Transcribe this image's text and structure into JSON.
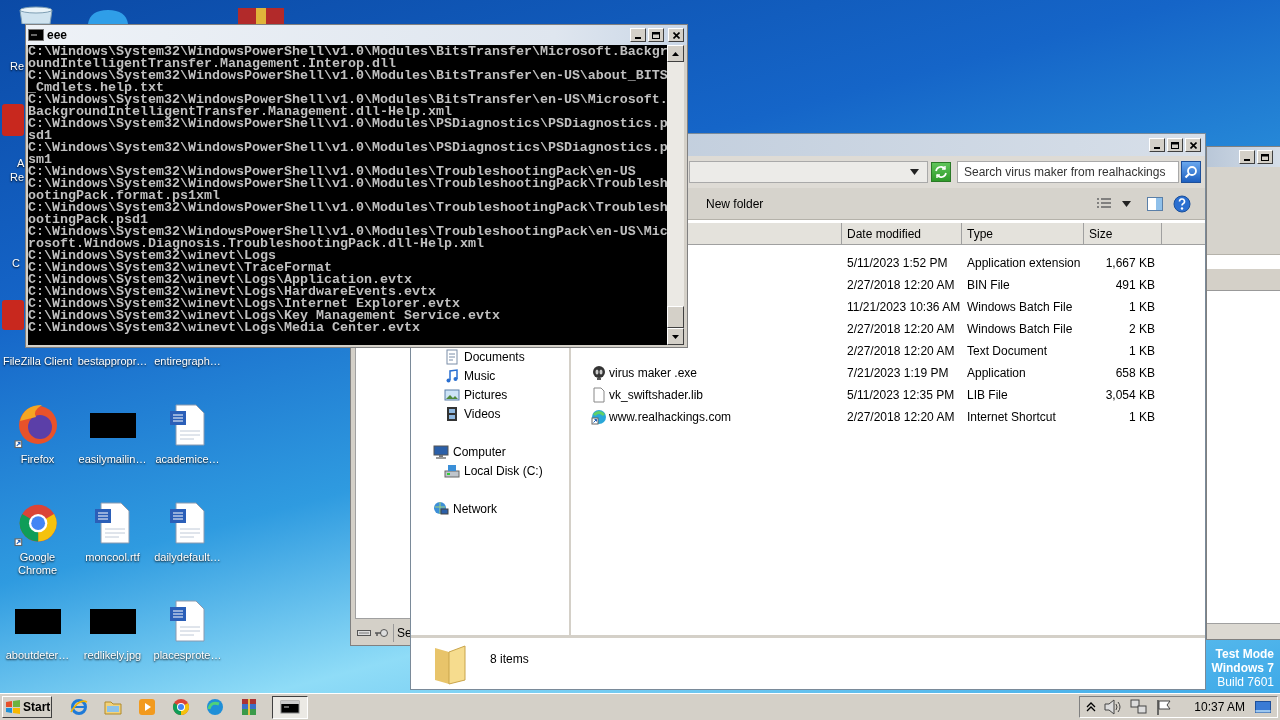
{
  "desktop": {
    "partial_labels": [
      "Re",
      "A",
      "Re",
      "C"
    ],
    "icons": [
      {
        "label": "FileZilla Client",
        "kind": "covered"
      },
      {
        "label": "bestappropr…",
        "kind": "covered"
      },
      {
        "label": "entiregraph…",
        "kind": "covered"
      },
      {
        "label": "Firefox",
        "kind": "firefox"
      },
      {
        "label": "easilymailin…",
        "kind": "thumb"
      },
      {
        "label": "academice…",
        "kind": "word"
      },
      {
        "label": "Google Chrome",
        "kind": "chrome"
      },
      {
        "label": "moncool.rtf",
        "kind": "word"
      },
      {
        "label": "dailydefault…",
        "kind": "word"
      },
      {
        "label": "aboutdeter…",
        "kind": "thumb"
      },
      {
        "label": "redlikely.jpg",
        "kind": "thumb"
      },
      {
        "label": "placesprote…",
        "kind": "word"
      }
    ]
  },
  "console": {
    "title": "eee",
    "lines": [
      "C:\\Windows\\System32\\WindowsPowerShell\\v1.0\\Modules\\BitsTransfer\\Microsoft.Backgr",
      "oundIntelligentTransfer.Management.Interop.dll",
      "C:\\Windows\\System32\\WindowsPowerShell\\v1.0\\Modules\\BitsTransfer\\en-US\\about_BITS",
      "_Cmdlets.help.txt",
      "C:\\Windows\\System32\\WindowsPowerShell\\v1.0\\Modules\\BitsTransfer\\en-US\\Microsoft.",
      "BackgroundIntelligentTransfer.Management.dll-Help.xml",
      "C:\\Windows\\System32\\WindowsPowerShell\\v1.0\\Modules\\PSDiagnostics\\PSDiagnostics.p",
      "sd1",
      "C:\\Windows\\System32\\WindowsPowerShell\\v1.0\\Modules\\PSDiagnostics\\PSDiagnostics.p",
      "sm1",
      "C:\\Windows\\System32\\WindowsPowerShell\\v1.0\\Modules\\TroubleshootingPack\\en-US",
      "C:\\Windows\\System32\\WindowsPowerShell\\v1.0\\Modules\\TroubleshootingPack\\Troublesh",
      "ootingPack.format.ps1xml",
      "C:\\Windows\\System32\\WindowsPowerShell\\v1.0\\Modules\\TroubleshootingPack\\Troublesh",
      "ootingPack.psd1",
      "C:\\Windows\\System32\\WindowsPowerShell\\v1.0\\Modules\\TroubleshootingPack\\en-US\\Mic",
      "rosoft.Windows.Diagnosis.TroubleshootingPack.dll-Help.xml",
      "C:\\Windows\\System32\\winevt\\Logs",
      "C:\\Windows\\System32\\winevt\\TraceFormat",
      "C:\\Windows\\System32\\winevt\\Logs\\Application.evtx",
      "C:\\Windows\\System32\\winevt\\Logs\\HardwareEvents.evtx",
      "C:\\Windows\\System32\\winevt\\Logs\\Internet Explorer.evtx",
      "C:\\Windows\\System32\\winevt\\Logs\\Key Management Service.evtx",
      "C:\\Windows\\System32\\winevt\\Logs\\Media Center.evtx"
    ]
  },
  "explorer": {
    "search": {
      "placeholder": "Search virus maker from realhackings"
    },
    "toolbar": {
      "new_folder": "New folder"
    },
    "columns": [
      "Date modified",
      "Type",
      "Size"
    ],
    "navigation": [
      {
        "children": [
          {
            "label": "Documents",
            "kind": "documents"
          },
          {
            "label": "Music",
            "kind": "music"
          },
          {
            "label": "Pictures",
            "kind": "pictures"
          },
          {
            "label": "Videos",
            "kind": "videos"
          }
        ]
      },
      {
        "label": "Computer",
        "kind": "computer",
        "children": [
          {
            "label": "Local Disk (C:)",
            "kind": "disk"
          }
        ]
      },
      {
        "label": "Network",
        "kind": "network"
      }
    ],
    "files": [
      {
        "date": "5/11/2023 1:52 PM",
        "type": "Application extension",
        "size": "1,667 KB"
      },
      {
        "date": "2/27/2018 12:20 AM",
        "type": "BIN File",
        "size": "491 KB"
      },
      {
        "date": "11/21/2023 10:36 AM",
        "type": "Windows Batch File",
        "size": "1 KB"
      },
      {
        "date": "2/27/2018 12:20 AM",
        "type": "Windows Batch File",
        "size": "2 KB"
      },
      {
        "date": "2/27/2018 12:20 AM",
        "type": "Text Document",
        "size": "1 KB"
      },
      {
        "name": "virus maker .exe",
        "kind": "app",
        "date": "7/21/2023 1:19 PM",
        "type": "Application",
        "size": "658 KB"
      },
      {
        "name": "vk_swiftshader.lib",
        "kind": "file",
        "date": "5/11/2023 12:35 PM",
        "type": "LIB File",
        "size": "3,054 KB"
      },
      {
        "name": "www.realhackings.com",
        "kind": "shortcut",
        "date": "2/27/2018 12:20 AM",
        "type": "Internet Shortcut",
        "size": "1 KB"
      }
    ],
    "status": "8 items"
  },
  "background_window": {
    "status_text": "Se"
  },
  "system": {
    "test_mode": [
      "Test Mode",
      "Windows 7",
      "Build 7601"
    ]
  },
  "taskbar": {
    "start": "Start",
    "pinned": [
      {
        "kind": "ie",
        "selected": false
      },
      {
        "kind": "explorer",
        "selected": false
      },
      {
        "kind": "media",
        "selected": false
      },
      {
        "kind": "chrome",
        "selected": false
      },
      {
        "kind": "edge",
        "selected": false
      },
      {
        "kind": "winrar",
        "selected": false
      },
      {
        "kind": "console",
        "selected": true
      }
    ],
    "clock": "10:37 AM"
  }
}
